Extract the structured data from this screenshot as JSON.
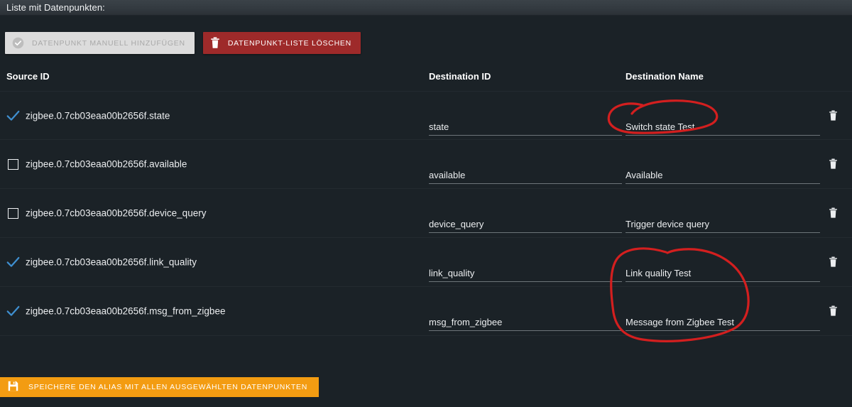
{
  "window": {
    "title": "Liste mit Datenpunkten:"
  },
  "toolbar": {
    "add_label": "Datenpunkt manuell hinzufügen",
    "add_icon": "check-circle-icon",
    "clear_label": "Datenpunkt-Liste löschen",
    "clear_icon": "trash-icon"
  },
  "table": {
    "headers": {
      "source_id": "Source ID",
      "destination_id": "Destination ID",
      "destination_name": "Destination Name"
    },
    "row_delete_icon": "trash-icon",
    "rows": [
      {
        "checked": true,
        "source_id": "zigbee.0.7cb03eaa00b2656f.state",
        "destination_id": "state",
        "destination_name": "Switch state Test"
      },
      {
        "checked": false,
        "source_id": "zigbee.0.7cb03eaa00b2656f.available",
        "destination_id": "available",
        "destination_name": "Available"
      },
      {
        "checked": false,
        "source_id": "zigbee.0.7cb03eaa00b2656f.device_query",
        "destination_id": "device_query",
        "destination_name": "Trigger device query"
      },
      {
        "checked": true,
        "source_id": "zigbee.0.7cb03eaa00b2656f.link_quality",
        "destination_id": "link_quality",
        "destination_name": "Link quality Test"
      },
      {
        "checked": true,
        "source_id": "zigbee.0.7cb03eaa00b2656f.msg_from_zigbee",
        "destination_id": "msg_from_zigbee",
        "destination_name": "Message from Zigbee Test"
      }
    ]
  },
  "save": {
    "label": "Speichere den Alias mit allen ausgewählten Datenpunkten",
    "icon": "save-disk-icon"
  },
  "annotations": {
    "color": "#d31f1f",
    "marks": [
      {
        "name": "circle-switch-state-test",
        "shape": "ellipse"
      },
      {
        "name": "circle-link-quality-and-message",
        "shape": "ellipse"
      }
    ]
  },
  "colors": {
    "background": "#1b2227",
    "titlebar": "#343b41",
    "accent_orange": "#f39c12",
    "danger_red": "#9e2a2a",
    "check_blue": "#3f8fd0",
    "annotation_red": "#d31f1f"
  }
}
